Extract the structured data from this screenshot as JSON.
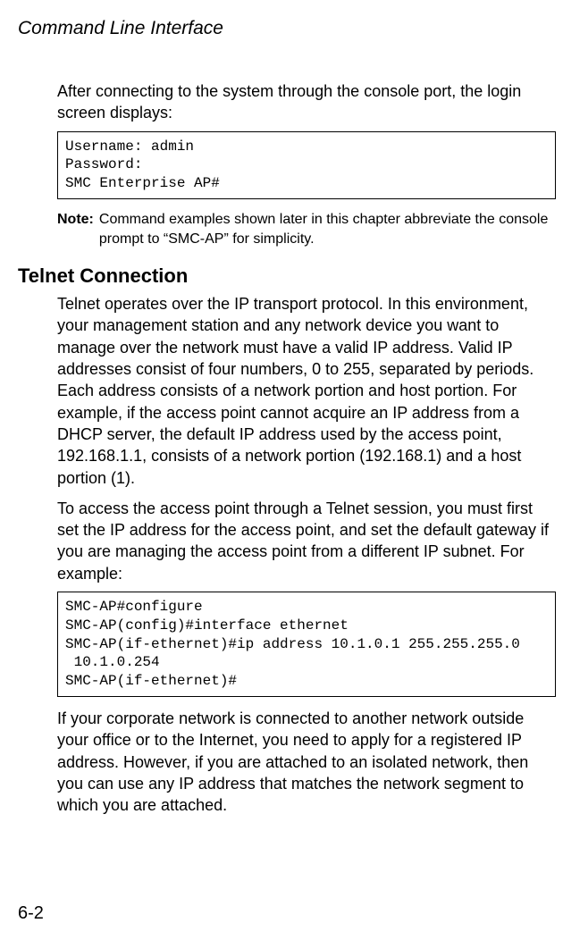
{
  "header": {
    "title": "Command Line Interface"
  },
  "intro": {
    "text": "After connecting to the system through the console port, the login screen displays:"
  },
  "codebox1": "Username: admin\nPassword:\nSMC Enterprise AP#",
  "note": {
    "label": "Note:",
    "text": "Command examples shown later in this chapter abbreviate the console prompt to “SMC-AP” for simplicity."
  },
  "section": {
    "heading": "Telnet Connection"
  },
  "para1": "Telnet operates over the IP transport protocol. In this environment, your management station and any network device you want to manage over the network must have a valid IP address. Valid IP addresses consist of four numbers, 0 to 255, separated by periods. Each address consists of a network portion and host portion. For example, if the access point cannot acquire an IP address from a DHCP server, the default IP address used by the access point, 192.168.1.1, consists of a network portion (192.168.1) and a host portion (1).",
  "para2": "To access the access point through a Telnet session, you must first set the IP address for the access point, and set the default gateway if you are managing the access point from a different IP subnet. For example:",
  "codebox2": "SMC-AP#configure\nSMC-AP(config)#interface ethernet\nSMC-AP(if-ethernet)#ip address 10.1.0.1 255.255.255.0\n 10.1.0.254\nSMC-AP(if-ethernet)#",
  "para3": "If your corporate network is connected to another network outside your office or to the Internet, you need to apply for a registered IP address. However, if you are attached to an isolated network, then you can use any IP address that matches the network segment to which you are attached.",
  "pagenum": "6-2"
}
